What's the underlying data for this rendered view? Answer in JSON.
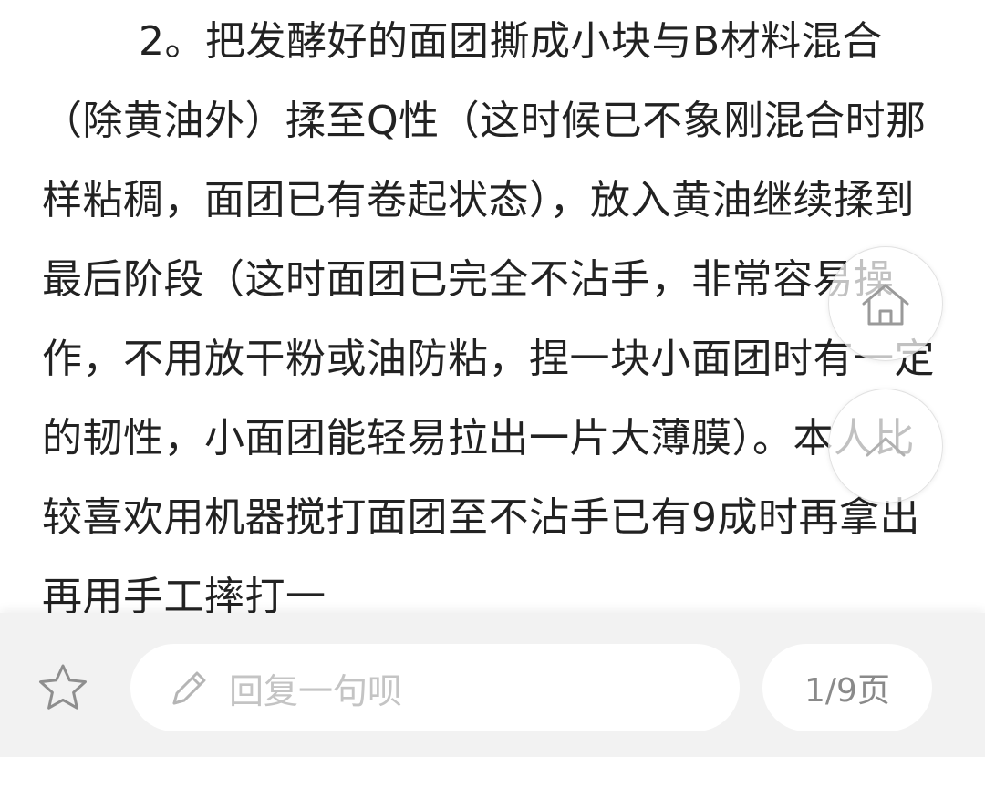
{
  "article": {
    "paragraph": "2。把发酵好的面团撕成小块与B材料混合（除黄油外）揉至Q性（这时候已不象刚混合时那样粘稠，面团已有卷起状态），放入黄油继续揉到最后阶段（这时面团已完全不沾手，非常容易操作，不用放干粉或油防粘，捏一块小面团时有一定的韧性，小面团能轻易拉出一片大薄膜）。本人比较喜欢用机器搅打面团至不沾手已有9成时再拿出再用手工摔打一"
  },
  "floating": {
    "home_icon": "home-icon",
    "top_icon": "chevron-up-icon"
  },
  "bottom_bar": {
    "favorite_icon": "star-icon",
    "reply_icon": "pencil-icon",
    "reply_placeholder": "回复一句呗",
    "page_indicator": "1/9页"
  },
  "colors": {
    "text": "#222222",
    "bar_background": "#f2f2f2",
    "placeholder": "#c4c4c4",
    "icon": "#9a9a9a"
  }
}
